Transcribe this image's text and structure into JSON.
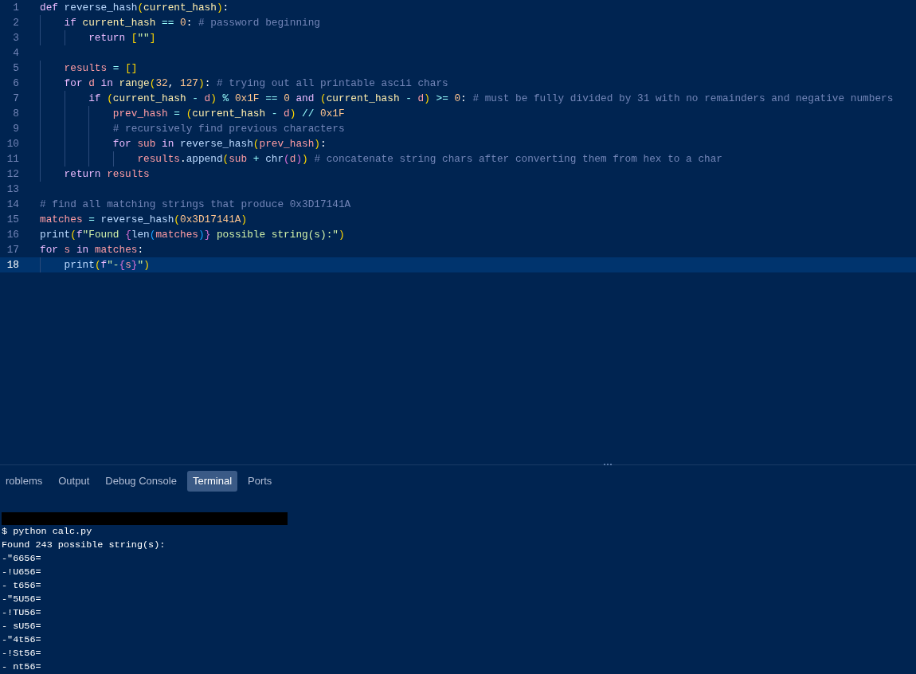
{
  "editor": {
    "lines": [
      {
        "number": "1",
        "selected": false,
        "tokens": [
          {
            "kind": "kw",
            "text": "def"
          },
          {
            "kind": "fn",
            "text": " reverse_hash"
          },
          {
            "kind": "b1",
            "text": "("
          },
          {
            "kind": "param",
            "text": "current_hash"
          },
          {
            "kind": "b1",
            "text": ")"
          },
          {
            "kind": "plain",
            "text": ":"
          }
        ]
      },
      {
        "number": "2",
        "selected": false,
        "tokens": [
          {
            "kind": "kw",
            "text": "    if"
          },
          {
            "kind": "param",
            "text": " current_hash"
          },
          {
            "kind": "op",
            "text": " =="
          },
          {
            "kind": "num",
            "text": " 0"
          },
          {
            "kind": "plain",
            "text": ":"
          },
          {
            "kind": "cm",
            "text": " # password beginning"
          }
        ]
      },
      {
        "number": "3",
        "selected": false,
        "tokens": [
          {
            "kind": "kw",
            "text": "        return"
          },
          {
            "kind": "b1",
            "text": " ["
          },
          {
            "kind": "str",
            "text": "\"\""
          },
          {
            "kind": "b1",
            "text": "]"
          }
        ]
      },
      {
        "number": "4",
        "selected": false
      },
      {
        "number": "5",
        "selected": false,
        "tokens": [
          {
            "kind": "var",
            "text": "    results"
          },
          {
            "kind": "op",
            "text": " ="
          },
          {
            "kind": "b1",
            "text": " []"
          }
        ]
      },
      {
        "number": "6",
        "selected": false,
        "tokens": [
          {
            "kind": "kw",
            "text": "    for"
          },
          {
            "kind": "var",
            "text": " d"
          },
          {
            "kind": "kw",
            "text": " in"
          },
          {
            "kind": "param",
            "text": " range"
          },
          {
            "kind": "b1",
            "text": "("
          },
          {
            "kind": "num",
            "text": "32"
          },
          {
            "kind": "plain",
            "text": ","
          },
          {
            "kind": "num",
            "text": " 127"
          },
          {
            "kind": "b1",
            "text": ")"
          },
          {
            "kind": "plain",
            "text": ":"
          },
          {
            "kind": "cm",
            "text": " # trying out all printable ascii chars"
          }
        ]
      },
      {
        "number": "7",
        "selected": false,
        "tokens": [
          {
            "kind": "kw",
            "text": "        if"
          },
          {
            "kind": "b1",
            "text": " ("
          },
          {
            "kind": "param",
            "text": "current_hash"
          },
          {
            "kind": "op",
            "text": " -"
          },
          {
            "kind": "var",
            "text": " d"
          },
          {
            "kind": "b1",
            "text": ")"
          },
          {
            "kind": "op",
            "text": " %"
          },
          {
            "kind": "num",
            "text": " 0x1F"
          },
          {
            "kind": "op",
            "text": " =="
          },
          {
            "kind": "num",
            "text": " 0"
          },
          {
            "kind": "kw",
            "text": " and"
          },
          {
            "kind": "b1",
            "text": " ("
          },
          {
            "kind": "param",
            "text": "current_hash"
          },
          {
            "kind": "op",
            "text": " -"
          },
          {
            "kind": "var",
            "text": " d"
          },
          {
            "kind": "b1",
            "text": ")"
          },
          {
            "kind": "op",
            "text": " >="
          },
          {
            "kind": "num",
            "text": " 0"
          },
          {
            "kind": "plain",
            "text": ":"
          },
          {
            "kind": "cm",
            "text": " # must be fully divided by 31 with no remainders and negative numbers"
          }
        ]
      },
      {
        "number": "8",
        "selected": false,
        "tokens": [
          {
            "kind": "var",
            "text": "            prev_hash"
          },
          {
            "kind": "op",
            "text": " ="
          },
          {
            "kind": "b1",
            "text": " ("
          },
          {
            "kind": "param",
            "text": "current_hash"
          },
          {
            "kind": "op",
            "text": " -"
          },
          {
            "kind": "var",
            "text": " d"
          },
          {
            "kind": "b1",
            "text": ")"
          },
          {
            "kind": "op",
            "text": " //"
          },
          {
            "kind": "num",
            "text": " 0x1F"
          }
        ]
      },
      {
        "number": "9",
        "selected": false,
        "tokens": [
          {
            "kind": "cm",
            "text": "            # recursively find previous characters"
          }
        ]
      },
      {
        "number": "10",
        "selected": false,
        "tokens": [
          {
            "kind": "kw",
            "text": "            for"
          },
          {
            "kind": "var",
            "text": " sub"
          },
          {
            "kind": "kw",
            "text": " in"
          },
          {
            "kind": "fn",
            "text": " reverse_hash"
          },
          {
            "kind": "b1",
            "text": "("
          },
          {
            "kind": "var",
            "text": "prev_hash"
          },
          {
            "kind": "b1",
            "text": ")"
          },
          {
            "kind": "plain",
            "text": ":"
          }
        ]
      },
      {
        "number": "11",
        "selected": false,
        "tokens": [
          {
            "kind": "var",
            "text": "                results"
          },
          {
            "kind": "plain",
            "text": "."
          },
          {
            "kind": "fn",
            "text": "append"
          },
          {
            "kind": "b1",
            "text": "("
          },
          {
            "kind": "var",
            "text": "sub"
          },
          {
            "kind": "op",
            "text": " +"
          },
          {
            "kind": "fn",
            "text": " chr"
          },
          {
            "kind": "b2",
            "text": "("
          },
          {
            "kind": "var",
            "text": "d"
          },
          {
            "kind": "b2",
            "text": ")"
          },
          {
            "kind": "b1",
            "text": ")"
          },
          {
            "kind": "cm",
            "text": " # concatenate string chars after converting them from hex to a char"
          }
        ]
      },
      {
        "number": "12",
        "selected": false,
        "tokens": [
          {
            "kind": "kw",
            "text": "    return"
          },
          {
            "kind": "var",
            "text": " results"
          }
        ]
      },
      {
        "number": "13",
        "selected": false
      },
      {
        "number": "14",
        "selected": false,
        "tokens": [
          {
            "kind": "cm",
            "text": "# find all matching strings that produce 0x3D17141A"
          }
        ]
      },
      {
        "number": "15",
        "selected": false,
        "tokens": [
          {
            "kind": "var",
            "text": "matches"
          },
          {
            "kind": "op",
            "text": " ="
          },
          {
            "kind": "fn",
            "text": " reverse_hash"
          },
          {
            "kind": "b1",
            "text": "("
          },
          {
            "kind": "num",
            "text": "0x3D17141A"
          },
          {
            "kind": "b1",
            "text": ")"
          }
        ]
      },
      {
        "number": "16",
        "selected": false,
        "tokens": [
          {
            "kind": "fn",
            "text": "print"
          },
          {
            "kind": "b1",
            "text": "("
          },
          {
            "kind": "kw",
            "text": "f"
          },
          {
            "kind": "str",
            "text": "\"Found "
          },
          {
            "kind": "b2",
            "text": "{"
          },
          {
            "kind": "fn",
            "text": "len"
          },
          {
            "kind": "b3",
            "text": "("
          },
          {
            "kind": "var",
            "text": "matches"
          },
          {
            "kind": "b3",
            "text": ")"
          },
          {
            "kind": "b2",
            "text": "}"
          },
          {
            "kind": "str",
            "text": " possible string(s):\""
          },
          {
            "kind": "b1",
            "text": ")"
          }
        ]
      },
      {
        "number": "17",
        "selected": false,
        "tokens": [
          {
            "kind": "kw",
            "text": "for"
          },
          {
            "kind": "var",
            "text": " s"
          },
          {
            "kind": "kw",
            "text": " in"
          },
          {
            "kind": "var",
            "text": " matches"
          },
          {
            "kind": "plain",
            "text": ":"
          }
        ]
      },
      {
        "number": "18",
        "selected": true,
        "tokens": [
          {
            "kind": "fn",
            "text": "    print"
          },
          {
            "kind": "b1",
            "text": "("
          },
          {
            "kind": "kw",
            "text": "f"
          },
          {
            "kind": "str",
            "text": "\"-"
          },
          {
            "kind": "b2",
            "text": "{"
          },
          {
            "kind": "var",
            "text": "s"
          },
          {
            "kind": "b2",
            "text": "}"
          },
          {
            "kind": "str",
            "text": "\""
          },
          {
            "kind": "b1",
            "text": ")"
          }
        ]
      }
    ]
  },
  "panel": {
    "tabs": [
      {
        "label": "roblems",
        "selected": false
      },
      {
        "label": "Output",
        "selected": false
      },
      {
        "label": "Debug Console",
        "selected": false
      },
      {
        "label": "Terminal",
        "selected": true
      },
      {
        "label": "Ports",
        "selected": false
      }
    ],
    "terminal": {
      "redacted": true,
      "lines": [
        "$ python calc.py",
        "Found 243 possible string(s):",
        "-\"6656=",
        "-!U656=",
        "- t656=",
        "-\"5U56=",
        "-!TU56=",
        "- sU56=",
        "-\"4t56=",
        "-!St56=",
        "- nt56="
      ]
    }
  }
}
